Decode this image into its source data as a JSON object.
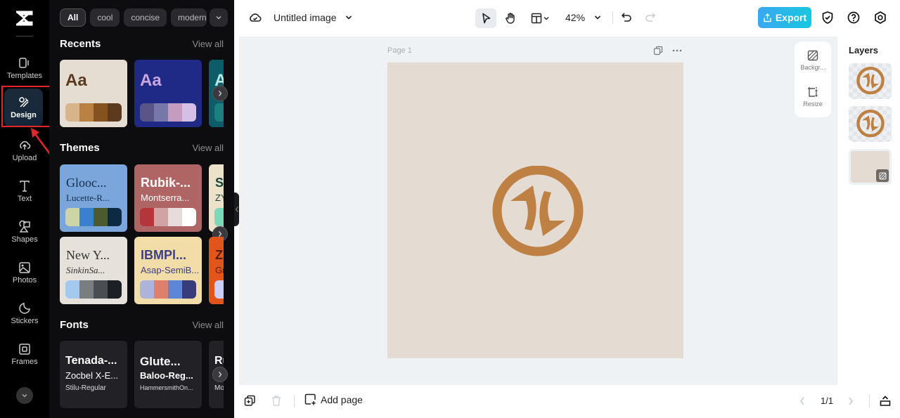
{
  "rail": {
    "items": [
      {
        "label": "Templates",
        "icon": "templates-icon"
      },
      {
        "label": "Design",
        "icon": "design-icon",
        "active": true
      },
      {
        "label": "Upload",
        "icon": "upload-icon"
      },
      {
        "label": "Text",
        "icon": "text-icon"
      },
      {
        "label": "Shapes",
        "icon": "shapes-icon"
      },
      {
        "label": "Photos",
        "icon": "photos-icon"
      },
      {
        "label": "Stickers",
        "icon": "stickers-icon"
      },
      {
        "label": "Frames",
        "icon": "frames-icon"
      }
    ]
  },
  "panel": {
    "chips": [
      "All",
      "cool",
      "concise",
      "modern"
    ],
    "recents": {
      "title": "Recents",
      "view_all": "View all",
      "cards": [
        {
          "label": "Aa",
          "bg": "#e6ddd2",
          "fg": "#5a3a1e",
          "swatches": [
            "#d8b48a",
            "#b98142",
            "#85521f",
            "#5c3a1d"
          ]
        },
        {
          "label": "Aa",
          "bg": "#1e2a85",
          "fg": "#c9a7e0",
          "swatches": [
            "#5b5488",
            "#7777aa",
            "#c69bc0",
            "#d6bfe6"
          ]
        },
        {
          "label": "A",
          "bg": "#0e5c6a",
          "fg": "#b8e8e0",
          "swatches": [
            "#1b7f80",
            "#1b7f80",
            "#1b7f80",
            "#1b7f80"
          ]
        }
      ]
    },
    "themes": {
      "title": "Themes",
      "view_all": "View all",
      "cards": [
        {
          "line1": "Glooc...",
          "line2": "Lucette-R...",
          "bg": "#7aa6dc",
          "fg": "#14304d",
          "serif": true,
          "swatches": [
            "#cdd4a5",
            "#3b7fcf",
            "#4b5b2d",
            "#0d2a44"
          ]
        },
        {
          "line1": "Rubik-...",
          "line2": "Montserra...",
          "bg": "#b06565",
          "fg": "#ffffff",
          "serif": false,
          "swatches": [
            "#b4363a",
            "#cea4a4",
            "#e6dcdc",
            "#ffffff"
          ]
        },
        {
          "line1": "Sp",
          "line2": "ZY",
          "bg": "#ece1c9",
          "fg": "#17443f",
          "serif": false,
          "swatches": [
            "#7fd6b8",
            "#7fd6b8",
            "#7fd6b8",
            "#7fd6b8"
          ]
        },
        {
          "line1": "New Y...",
          "line2": "SinkinSa...",
          "bg": "#e6e1db",
          "fg": "#333333",
          "serif": true,
          "swatches": [
            "#a3c9f1",
            "#7a7e80",
            "#4a4d52",
            "#1c1f24"
          ]
        },
        {
          "line1": "IBMPl...",
          "line2": "Asap-SemiB...",
          "bg": "#f2dca8",
          "fg": "#3b3f86",
          "serif": false,
          "swatches": [
            "#aeb3dc",
            "#e07f6b",
            "#5d86d6",
            "#383b7c"
          ]
        },
        {
          "line1": "Z",
          "line2": "Gro",
          "bg": "#e0561a",
          "fg": "#5a1d05",
          "serif": false,
          "swatches": [
            "#cdd0f4",
            "#cdd0f4",
            "#cdd0f4",
            "#cdd0f4"
          ]
        }
      ]
    },
    "fonts": {
      "title": "Fonts",
      "view_all": "View all",
      "cards": [
        {
          "line1": "Tenada-...",
          "line2": "Zocbel X-E...",
          "line3": "Stilu-Regular"
        },
        {
          "line1": "Glute...",
          "line2": "Baloo-Reg...",
          "line3": "HammersmithOn..."
        },
        {
          "line1": "Ru",
          "line2": "",
          "line3": "Mor"
        }
      ]
    }
  },
  "topbar": {
    "doc_title": "Untitled image",
    "zoom": "42%",
    "export_label": "Export"
  },
  "canvas": {
    "page_label": "Page 1",
    "page_bg": "#e4dbd2",
    "icon_color": "#bf8044"
  },
  "float_tools": [
    {
      "label": "Backgr..."
    },
    {
      "label": "Resize"
    }
  ],
  "layers": {
    "title": "Layers"
  },
  "bottombar": {
    "add_page": "Add page",
    "page_count": "1/1"
  }
}
